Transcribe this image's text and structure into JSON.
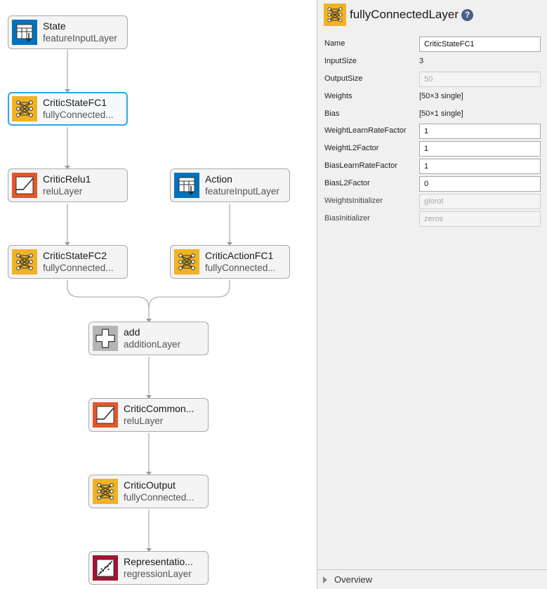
{
  "graph": {
    "nodes": [
      {
        "id": "state",
        "name": "State",
        "type": "featureInputLayer",
        "icon": "feature-input-icon",
        "selected": false
      },
      {
        "id": "critic-state-fc1",
        "name": "CriticStateFC1",
        "type": "fullyConnected...",
        "icon": "fully-connected-icon",
        "selected": true
      },
      {
        "id": "critic-relu1",
        "name": "CriticRelu1",
        "type": "reluLayer",
        "icon": "relu-icon",
        "selected": false
      },
      {
        "id": "action",
        "name": "Action",
        "type": "featureInputLayer",
        "icon": "feature-input-icon",
        "selected": false
      },
      {
        "id": "critic-state-fc2",
        "name": "CriticStateFC2",
        "type": "fullyConnected...",
        "icon": "fully-connected-icon",
        "selected": false
      },
      {
        "id": "critic-action-fc1",
        "name": "CriticActionFC1",
        "type": "fullyConnected...",
        "icon": "fully-connected-icon",
        "selected": false
      },
      {
        "id": "add",
        "name": "add",
        "type": "additionLayer",
        "icon": "addition-icon",
        "selected": false
      },
      {
        "id": "critic-common",
        "name": "CriticCommon...",
        "type": "reluLayer",
        "icon": "relu-icon",
        "selected": false
      },
      {
        "id": "critic-output",
        "name": "CriticOutput",
        "type": "fullyConnected...",
        "icon": "fully-connected-icon",
        "selected": false
      },
      {
        "id": "representation",
        "name": "Representatio...",
        "type": "regressionLayer",
        "icon": "regression-icon",
        "selected": false
      }
    ],
    "colors": {
      "fully_connected": "#f0b323",
      "relu": "#e2582a",
      "feature_input": "#0072bd",
      "addition": "#b5b5b5",
      "regression": "#a2142f",
      "selection": "#2ea8e6",
      "edge": "#b0b0b0"
    }
  },
  "panel": {
    "title": "fullyConnectedLayer",
    "title_icon": "fully-connected-icon",
    "help_icon": "?",
    "properties": [
      {
        "label": "Name",
        "kind": "input",
        "value": "CriticStateFC1",
        "enabled": true
      },
      {
        "label": "InputSize",
        "kind": "text",
        "value": "3"
      },
      {
        "label": "OutputSize",
        "kind": "input",
        "value": "50",
        "enabled": false
      },
      {
        "label": "Weights",
        "kind": "text",
        "value": "[50×3 single]"
      },
      {
        "label": "Bias",
        "kind": "text",
        "value": "[50×1 single]"
      },
      {
        "label": "WeightLearnRateFactor",
        "kind": "input",
        "value": "1",
        "enabled": true
      },
      {
        "label": "WeightL2Factor",
        "kind": "input",
        "value": "1",
        "enabled": true
      },
      {
        "label": "BiasLearnRateFactor",
        "kind": "input",
        "value": "1",
        "enabled": true
      },
      {
        "label": "BiasL2Factor",
        "kind": "input",
        "value": "0",
        "enabled": true
      },
      {
        "label": "WeightsInitializer",
        "kind": "input",
        "value": "glorot",
        "enabled": false
      },
      {
        "label": "BiasInitializer",
        "kind": "input",
        "value": "zeros",
        "enabled": false
      }
    ],
    "overview_label": "Overview"
  }
}
